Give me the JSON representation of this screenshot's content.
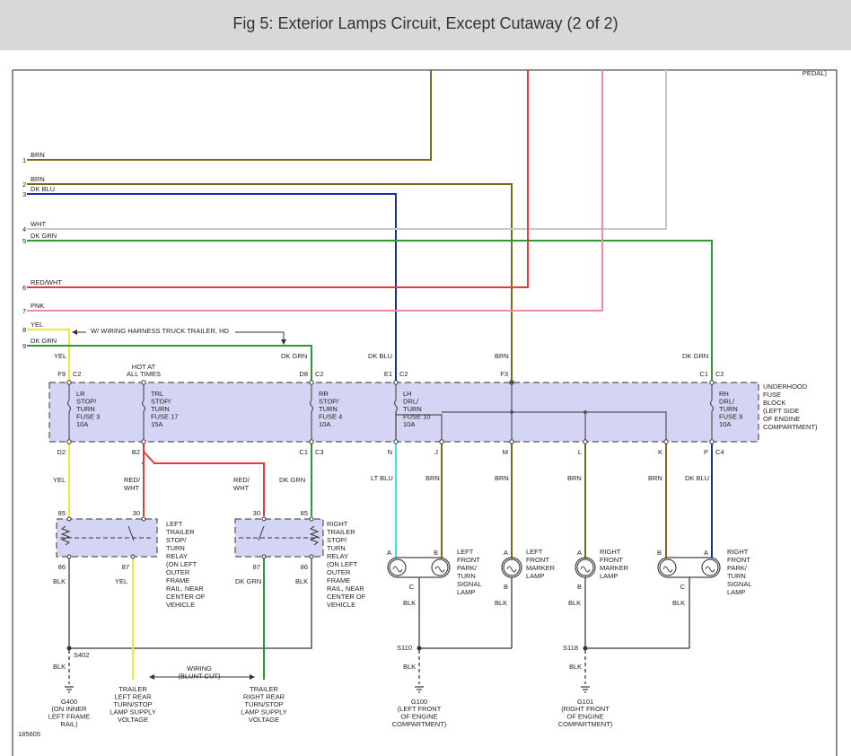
{
  "title": "Fig 5: Exterior Lamps Circuit, Except Cutaway (2 of 2)",
  "colors": {
    "BRN": "#7a6a1a",
    "DK BLU": "#1a2f9c",
    "WHT": "#c8c8c8",
    "DK GRN": "#2e9a2e",
    "RED/WHT": "#e83a3a",
    "PNK": "#f08aa0",
    "YEL": "#f2ea2a",
    "LT BLU": "#40e0f0",
    "BLK": "#555555",
    "fuse_block": "#d4d4f4"
  },
  "top_right": "PEDAL)",
  "left_wires": [
    {
      "num": "1",
      "color": "BRN"
    },
    {
      "num": "2",
      "color": "BRN"
    },
    {
      "num": "3",
      "color": "DK BLU"
    },
    {
      "num": "4",
      "color": "WHT"
    },
    {
      "num": "5",
      "color": "DK GRN"
    },
    {
      "num": "6",
      "color": "RED/WHT"
    },
    {
      "num": "7",
      "color": "PNK"
    },
    {
      "num": "8",
      "color": "YEL"
    },
    {
      "num": "9",
      "color": "DK GRN"
    }
  ],
  "harness_note": "W/ WIRING HARNESS TRUCK TRAILER, HD",
  "fuse_block_label": [
    "UNDERHOOD",
    "FUSE",
    "BLOCK",
    "(LEFT SIDE",
    "OF ENGINE",
    "COMPARTMENT)"
  ],
  "hot_at": [
    "HOT AT",
    "ALL TIMES"
  ],
  "fuses": [
    {
      "in": "F9",
      "conn": "C2",
      "lines": [
        "LR",
        "STOP/",
        "TURN",
        "FUSE 3",
        "10A"
      ],
      "out": "D2",
      "out_conn": ""
    },
    {
      "in": "",
      "conn": "",
      "lines": [
        "TRL",
        "STOP/",
        "TURN",
        "FUSE 17",
        "15A"
      ],
      "out": "B2",
      "out_conn": ""
    },
    {
      "in": "D8",
      "conn": "C2",
      "lines": [
        "RR",
        "STOP/",
        "TURN",
        "FUSE 4",
        "10A"
      ],
      "out": "C1",
      "out_conn": "C3"
    },
    {
      "in": "E1",
      "conn": "C2",
      "lines": [
        "LH",
        "DRL/",
        "TURN",
        "FUSE 10",
        "10A"
      ],
      "out": "N",
      "out_conn": ""
    },
    {
      "in": "F3",
      "conn": "",
      "lines": [],
      "out": "M",
      "out_conn": ""
    },
    {
      "in": "C1",
      "conn": "C2",
      "lines": [
        "RH",
        "DRL/",
        "TURN",
        "FUSE 9",
        "10A"
      ],
      "out": "P",
      "out_conn": "C4"
    }
  ],
  "bus_outputs": [
    "J",
    "L",
    "K"
  ],
  "wire_labels_top": {
    "yel": "YEL",
    "dkgrn_rr": "DK GRN",
    "dkblu": "DK BLU",
    "brn": "BRN",
    "dkgrn_rh": "DK GRN"
  },
  "wire_labels_mid": {
    "yel": "YEL",
    "redwht1": "RED/\nWHT",
    "redwht2": "RED/\nWHT",
    "dkgrn": "DK GRN",
    "ltblu": "LT BLU",
    "brn_j": "BRN",
    "brn_m": "BRN",
    "brn_l": "BRN",
    "brn_k": "BRN",
    "dkblu": "DK BLU"
  },
  "relays": [
    {
      "label": [
        "LEFT",
        "TRAILER",
        "STOP/",
        "TURN",
        "RELAY",
        "(ON LEFT",
        "OUTER",
        "FRAME",
        "RAIL, NEAR",
        "CENTER OF",
        "VEHICLE"
      ],
      "pins": {
        "a": "85",
        "b": "30",
        "c": "86",
        "d": "87"
      },
      "wires": {
        "c": "BLK",
        "d": "YEL"
      }
    },
    {
      "label": [
        "RIGHT",
        "TRAILER",
        "STOP/",
        "TURN",
        "RELAY",
        "(ON LEFT",
        "OUTER",
        "FRAME",
        "RAIL, NEAR",
        "CENTER OF",
        "VEHICLE"
      ],
      "pins": {
        "a": "30",
        "b": "85",
        "c": "87",
        "d": "86"
      },
      "wires": {
        "c": "DK GRN",
        "d": "BLK"
      }
    }
  ],
  "lamps": [
    {
      "label": [
        "LEFT",
        "FRONT",
        "PARK/",
        "TURN",
        "SIGNAL",
        "LAMP"
      ],
      "pins": [
        "A",
        "B",
        "C"
      ],
      "ground": "BLK"
    },
    {
      "label": [
        "LEFT",
        "FRONT",
        "MARKER",
        "LAMP"
      ],
      "pins": [
        "A",
        "B"
      ],
      "ground": "BLK"
    },
    {
      "label": [
        "RIGHT",
        "FRONT",
        "MARKER",
        "LAMP"
      ],
      "pins": [
        "A",
        "B"
      ],
      "ground": "BLK"
    },
    {
      "label": [
        "RIGHT",
        "FRONT",
        "PARK/",
        "TURN",
        "SIGNAL",
        "LAMP"
      ],
      "pins": [
        "B",
        "A",
        "C"
      ],
      "ground": "BLK"
    }
  ],
  "splices": [
    "S402",
    "S110",
    "S118"
  ],
  "ground_wire": "BLK",
  "grounds": [
    {
      "id": "G400",
      "lines": [
        "(ON INNER",
        "LEFT FRAME",
        "RAIL)"
      ]
    },
    {
      "id": "G100",
      "lines": [
        "(LEFT FRONT",
        "OF ENGINE",
        "COMPARTMENT)"
      ]
    },
    {
      "id": "G101",
      "lines": [
        "(RIGHT FRONT",
        "OF ENGINE",
        "COMPARTMENT)"
      ]
    }
  ],
  "supply_left": [
    "TRAILER",
    "LEFT REAR",
    "TURN/STOP",
    "LAMP SUPPLY",
    "VOLTAGE"
  ],
  "supply_right": [
    "TRAILER",
    "RIGHT REAR",
    "TURN/STOP",
    "LAMP SUPPLY",
    "VOLTAGE"
  ],
  "wiring_note": [
    "WIRING",
    "(BLUNT CUT)"
  ],
  "figure_id": "185605"
}
